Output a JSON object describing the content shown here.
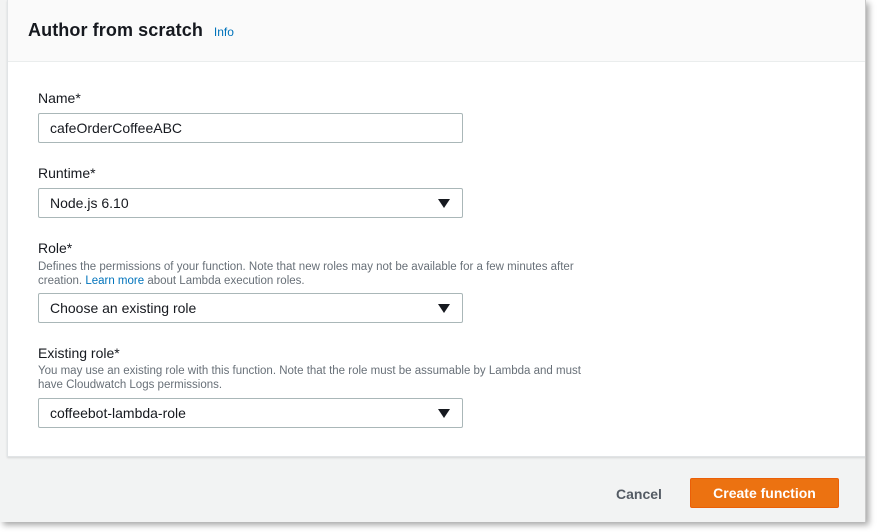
{
  "panel": {
    "title": "Author from scratch",
    "info_link": "Info"
  },
  "fields": {
    "name": {
      "label": "Name*",
      "value": "cafeOrderCoffeeABC"
    },
    "runtime": {
      "label": "Runtime*",
      "selected": "Node.js 6.10"
    },
    "role": {
      "label": "Role*",
      "description": "Defines the permissions of your function. Note that new roles may not be available for a few minutes after creation.",
      "link": "Learn more",
      "link_suffix": "about Lambda execution roles.",
      "selected": "Choose an existing role"
    },
    "existing_role": {
      "label": "Existing role*",
      "description": "You may use an existing role with this function. Note that the role must be assumable by Lambda and must have Cloudwatch Logs permissions.",
      "selected": "coffeebot-lambda-role"
    }
  },
  "footer": {
    "cancel_label": "Cancel",
    "create_label": "Create function"
  },
  "colors": {
    "accent": "#ec7211",
    "link": "#0073bb",
    "text": "#16191f",
    "muted": "#687078"
  }
}
